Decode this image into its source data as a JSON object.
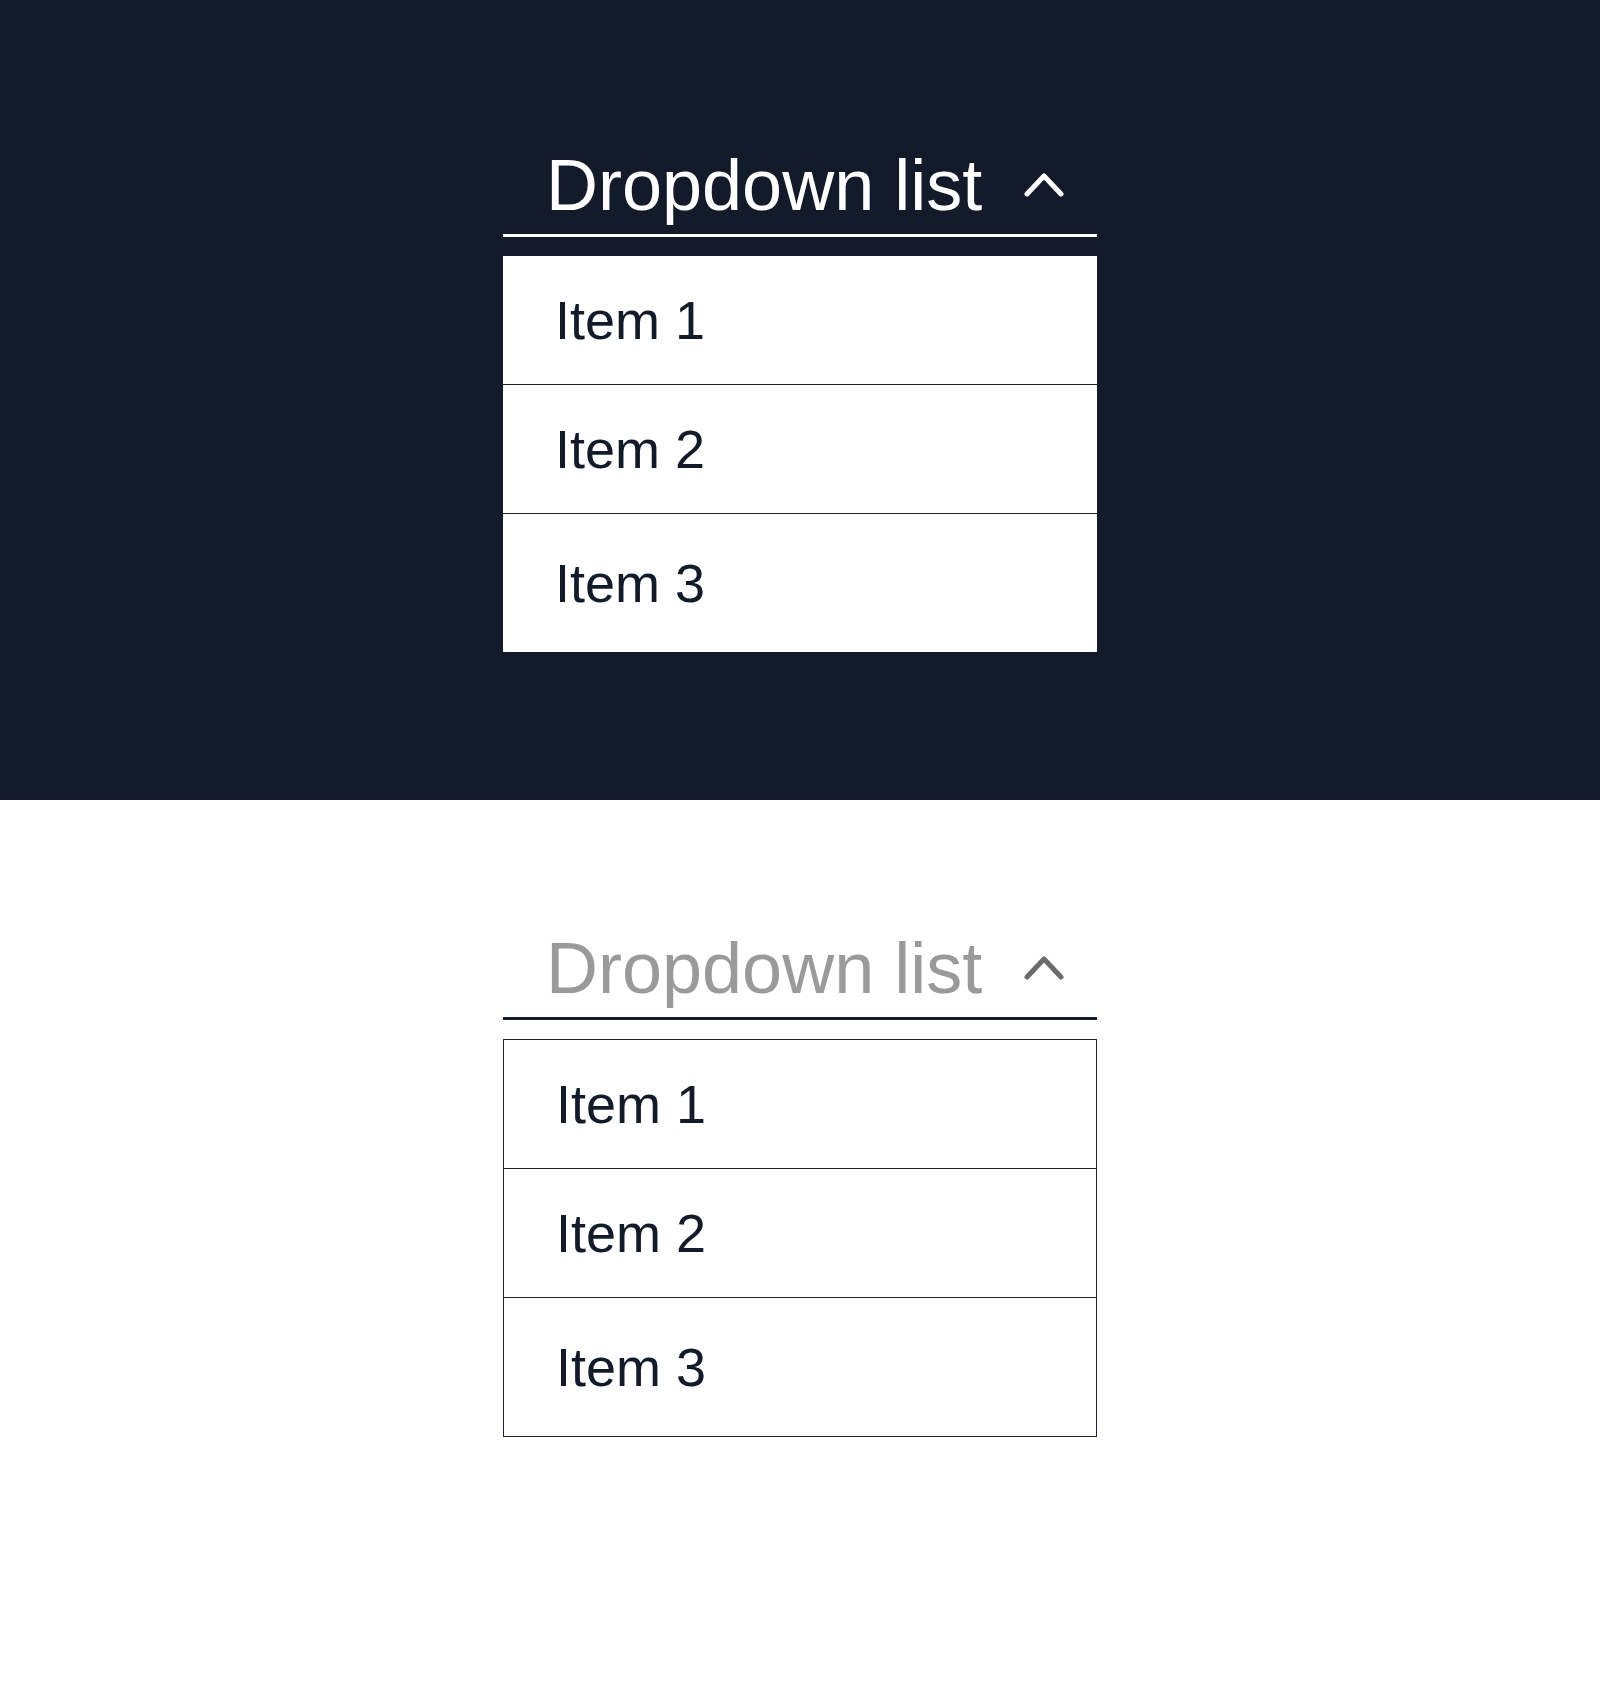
{
  "panels": [
    {
      "kind": "dark",
      "dropdown": {
        "title": "Dropdown list",
        "expanded": true,
        "items": [
          {
            "label": "Item 1"
          },
          {
            "label": "Item 2"
          },
          {
            "label": "Item 3"
          }
        ]
      }
    },
    {
      "kind": "light",
      "dropdown": {
        "title": "Dropdown list",
        "expanded": true,
        "items": [
          {
            "label": "Item 1"
          },
          {
            "label": "Item 2"
          },
          {
            "label": "Item 3"
          }
        ]
      }
    }
  ]
}
